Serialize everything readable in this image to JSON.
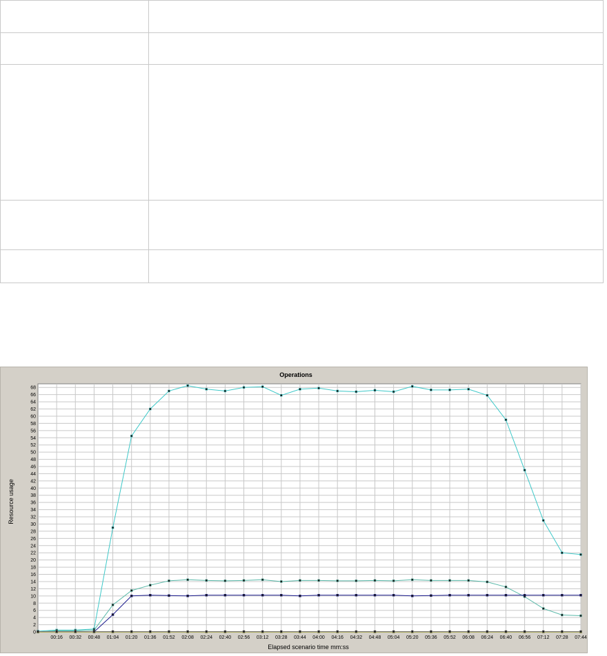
{
  "info_table": {
    "rows": [
      {
        "label": "",
        "value": ""
      },
      {
        "label": "",
        "value": ""
      },
      {
        "label": "",
        "value": ""
      },
      {
        "label": "",
        "value": ""
      },
      {
        "label": "",
        "value": ""
      }
    ]
  },
  "chart_data": {
    "type": "line",
    "title": "Operations",
    "xlabel": "Elapsed scenario time mm:ss",
    "ylabel": "Resource usage",
    "ylim": [
      0,
      69
    ],
    "yticks": [
      0,
      2,
      4,
      6,
      8,
      10,
      12,
      14,
      16,
      18,
      20,
      22,
      24,
      26,
      28,
      30,
      32,
      34,
      36,
      38,
      40,
      42,
      44,
      46,
      48,
      50,
      52,
      54,
      56,
      58,
      60,
      62,
      64,
      66,
      68
    ],
    "x_tick_labels": [
      "00:16",
      "00:32",
      "00:48",
      "01:04",
      "01:20",
      "01:36",
      "01:52",
      "02:08",
      "02:24",
      "02:40",
      "02:56",
      "03:12",
      "03:28",
      "03:44",
      "04:00",
      "04:16",
      "04:32",
      "04:48",
      "05:04",
      "05:20",
      "05:36",
      "05:52",
      "06:08",
      "06:24",
      "06:40",
      "06:56",
      "07:12",
      "07:28",
      "07:44"
    ],
    "x": [
      "00:00",
      "00:16",
      "00:32",
      "00:48",
      "01:04",
      "01:20",
      "01:36",
      "01:52",
      "02:08",
      "02:24",
      "02:40",
      "02:56",
      "03:12",
      "03:28",
      "03:44",
      "04:00",
      "04:16",
      "04:32",
      "04:48",
      "05:04",
      "05:20",
      "05:36",
      "05:52",
      "06:08",
      "06:24",
      "06:40",
      "06:56",
      "07:12",
      "07:28",
      "07:44"
    ],
    "grid": true,
    "series": [
      {
        "color": "#3cc8c8",
        "values": [
          0.2,
          0.5,
          0.5,
          0.8,
          29,
          54.5,
          62,
          67,
          68.5,
          67.5,
          67,
          68,
          68.2,
          65.8,
          67.5,
          67.8,
          67,
          66.8,
          67.2,
          66.8,
          68.3,
          67.3,
          67.3,
          67.5,
          65.8,
          59,
          45,
          31,
          22,
          21.5
        ]
      },
      {
        "color": "#58b8a8",
        "values": [
          0,
          0.3,
          0.3,
          0.5,
          7.5,
          11.5,
          13,
          14.2,
          14.5,
          14.3,
          14.2,
          14.3,
          14.5,
          14,
          14.3,
          14.3,
          14.2,
          14.2,
          14.3,
          14.2,
          14.5,
          14.3,
          14.3,
          14.3,
          13.9,
          12.5,
          9.8,
          6.5,
          4.7,
          4.5
        ]
      },
      {
        "color": "#1a1a8c",
        "values": [
          0,
          0,
          0,
          0,
          4.8,
          10,
          10.2,
          10.1,
          10,
          10.2,
          10.2,
          10.2,
          10.2,
          10.2,
          10,
          10.2,
          10.2,
          10.2,
          10.2,
          10.2,
          10,
          10.1,
          10.2,
          10.2,
          10.2,
          10.2,
          10.2,
          10.2,
          10.2,
          10.2
        ]
      },
      {
        "color": "#8c8c00",
        "values": [
          0,
          0,
          0,
          0,
          0,
          0,
          0,
          0,
          0,
          0,
          0,
          0,
          0,
          0,
          0,
          0,
          0,
          0,
          0,
          0,
          0,
          0,
          0,
          0,
          0,
          0,
          0,
          0,
          0,
          0
        ]
      },
      {
        "color": "#7d7d7d",
        "values": [
          0.1,
          0.1,
          0.1,
          0.1,
          0.1,
          0.1,
          0.1,
          0.1,
          0.1,
          0.1,
          0.1,
          0.1,
          0.1,
          0.1,
          0.1,
          0.1,
          0.1,
          0.1,
          0.1,
          0.1,
          0.1,
          0.1,
          0.1,
          0.1,
          0.1,
          0.1,
          0.1,
          0.1,
          0.1,
          0.1
        ]
      }
    ]
  }
}
